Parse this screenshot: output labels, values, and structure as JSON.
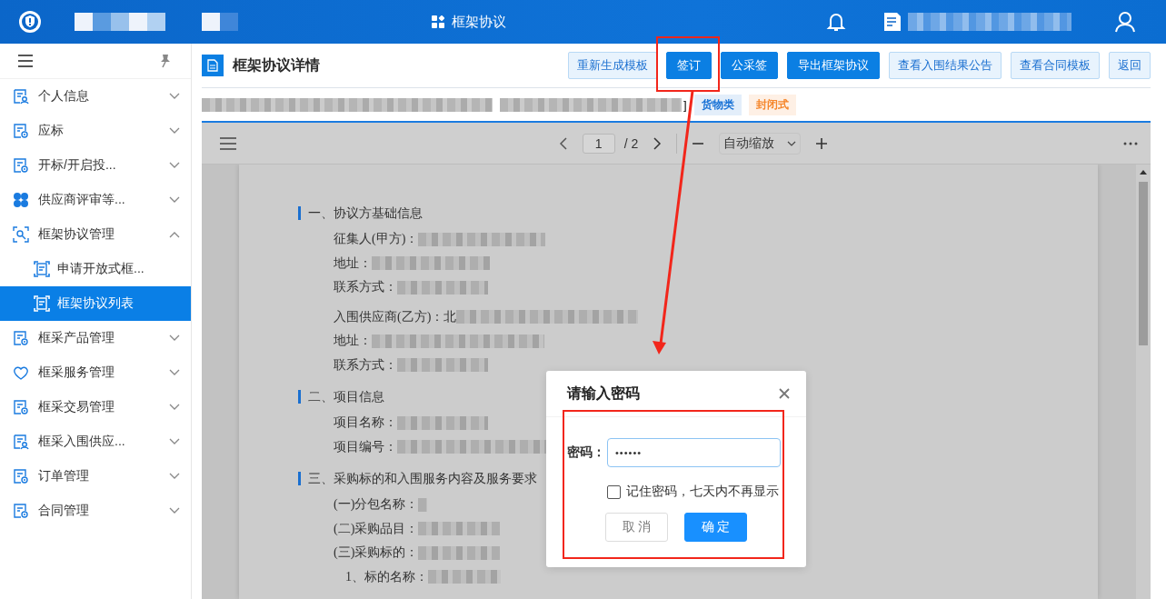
{
  "header": {
    "nav_item": "框架协议"
  },
  "sidebar": {
    "items": [
      {
        "label": "个人信息",
        "expanded": false,
        "selected": false
      },
      {
        "label": "应标",
        "expanded": false,
        "selected": false
      },
      {
        "label": "开标/开启投...",
        "expanded": false,
        "selected": false
      },
      {
        "label": "供应商评审等...",
        "expanded": false,
        "selected": false
      },
      {
        "label": "框架协议管理",
        "expanded": true,
        "selected": false,
        "children": [
          {
            "label": "申请开放式框...",
            "selected": false
          },
          {
            "label": "框架协议列表",
            "selected": true
          }
        ]
      },
      {
        "label": "框采产品管理",
        "expanded": false,
        "selected": false
      },
      {
        "label": "框采服务管理",
        "expanded": false,
        "selected": false
      },
      {
        "label": "框采交易管理",
        "expanded": false,
        "selected": false
      },
      {
        "label": "框采入围供应...",
        "expanded": false,
        "selected": false
      },
      {
        "label": "订单管理",
        "expanded": false,
        "selected": false
      },
      {
        "label": "合同管理",
        "expanded": false,
        "selected": false
      }
    ]
  },
  "page_title": "框架协议详情",
  "buttons": [
    {
      "label": "重新生成模板",
      "kind": "plain"
    },
    {
      "label": "签订",
      "kind": "primary"
    },
    {
      "label": "公采签",
      "kind": "primary"
    },
    {
      "label": "导出框架协议",
      "kind": "primary"
    },
    {
      "label": "查看入围结果公告",
      "kind": "plain"
    },
    {
      "label": "查看合同模板",
      "kind": "plain"
    },
    {
      "label": "返回",
      "kind": "plain"
    }
  ],
  "info": {
    "bracket": "]",
    "tags": [
      {
        "label": "货物类",
        "color": "#1a73d6"
      },
      {
        "label": "封闭式",
        "color": "#f5862b"
      }
    ]
  },
  "pdf": {
    "page": "1",
    "total": "/ 2",
    "zoom": "自动缩放",
    "sections": [
      {
        "heading": "一、协议方基础信息",
        "lines": [
          {
            "label": "征集人(甲方)：",
            "kind": "line"
          },
          {
            "label": "地址：",
            "kind": "line"
          },
          {
            "label": "联系方式：",
            "kind": "line"
          },
          {
            "label": "入围供应商(乙方)：北",
            "kind": "gap"
          },
          {
            "label": "地址：",
            "kind": "line"
          },
          {
            "label": "联系方式：",
            "kind": "line"
          }
        ]
      },
      {
        "heading": "二、项目信息",
        "lines": [
          {
            "label": "项目名称：",
            "kind": "line"
          },
          {
            "label": "项目编号：",
            "kind": "line"
          }
        ]
      },
      {
        "heading": "三、采购标的和入围服务内容及服务要求",
        "lines": [
          {
            "label": "(一)分包名称：",
            "kind": "line"
          },
          {
            "label": "(二)采购品目：",
            "kind": "line"
          },
          {
            "label": "(三)采购标的：",
            "kind": "line"
          },
          {
            "label": "1、标的名称：",
            "kind": "sub"
          }
        ]
      }
    ]
  },
  "dialog": {
    "title": "请输入密码",
    "field_label": "密码：",
    "value": "••••••",
    "remember": {
      "label": "记住密码，七天内不再显示",
      "checked": false
    },
    "cancel": "取 消",
    "confirm": "确 定"
  }
}
